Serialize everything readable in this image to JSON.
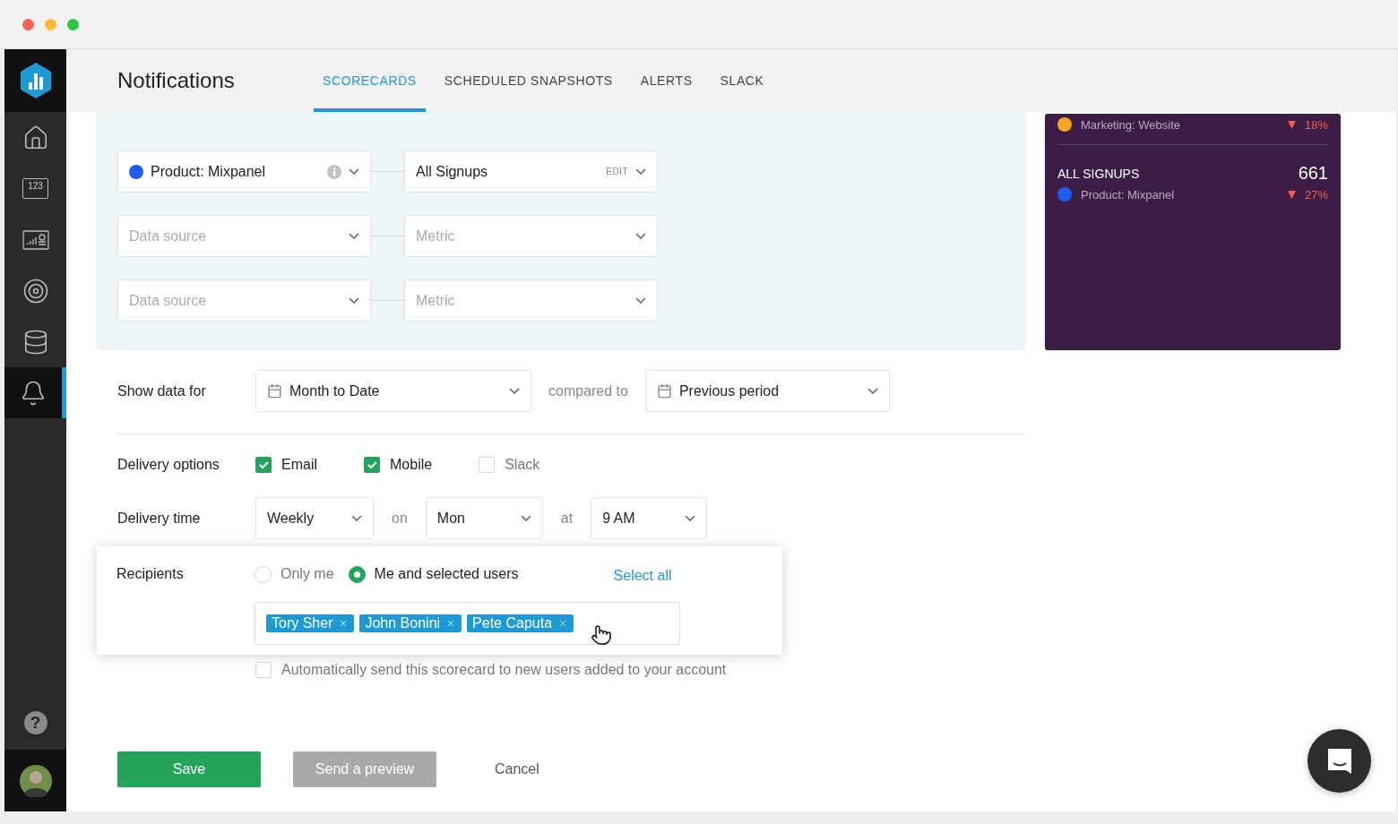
{
  "sidebar": {
    "items": [
      {
        "kind": "home",
        "selected": false
      },
      {
        "kind": "numbers",
        "text": "123",
        "selected": false
      },
      {
        "kind": "dashboard",
        "selected": false
      },
      {
        "kind": "goals",
        "selected": false
      },
      {
        "kind": "databases",
        "selected": false
      },
      {
        "kind": "notifications",
        "selected": true
      }
    ],
    "help": {
      "label": "?"
    }
  },
  "header": {
    "title": "Notifications",
    "tabs": [
      {
        "label": "SCORECARDS",
        "selected": true
      },
      {
        "label": "SCHEDULED SNAPSHOTS",
        "selected": false
      },
      {
        "label": "ALERTS",
        "selected": false
      },
      {
        "label": "SLACK",
        "selected": false
      }
    ]
  },
  "metrics": [
    {
      "source": "Product: Mixpanel",
      "color": "#1f5cf5",
      "metric": "All Signups",
      "edit_label": "EDIT",
      "info": true
    },
    {
      "source_placeholder": "Data source",
      "metric_placeholder": "Metric"
    },
    {
      "source_placeholder": "Data source",
      "metric_placeholder": "Metric"
    }
  ],
  "preview": {
    "items": [
      {
        "source": "Marketing: Website",
        "color": "#f5a623",
        "change": "18%"
      },
      {
        "title": "ALL SIGNUPS",
        "value": "661",
        "source": "Product: Mixpanel",
        "color": "#1f5cf5",
        "change": "27%"
      }
    ]
  },
  "show_data": {
    "label": "Show data for",
    "period": "Month to Date",
    "compared_label": "compared to",
    "comparison": "Previous period"
  },
  "delivery_options": {
    "label": "Delivery options",
    "options": [
      {
        "label": "Email",
        "checked": true
      },
      {
        "label": "Mobile",
        "checked": true
      },
      {
        "label": "Slack",
        "checked": false
      }
    ]
  },
  "delivery_time": {
    "label": "Delivery time",
    "frequency": "Weekly",
    "on_label": "on",
    "day": "Mon",
    "at_label": "at",
    "time": "9 AM"
  },
  "recipients": {
    "label": "Recipients",
    "options": [
      {
        "label": "Only me",
        "selected": false
      },
      {
        "label": "Me and selected users",
        "selected": true
      }
    ],
    "select_all": "Select all",
    "users": [
      "Tory Sher",
      "John Bonini",
      "Pete Caputa"
    ]
  },
  "auto_send": {
    "label": "Automatically send this scorecard to new users added to your account",
    "checked": false
  },
  "buttons": {
    "save": "Save",
    "preview": "Send a preview",
    "cancel": "Cancel"
  }
}
